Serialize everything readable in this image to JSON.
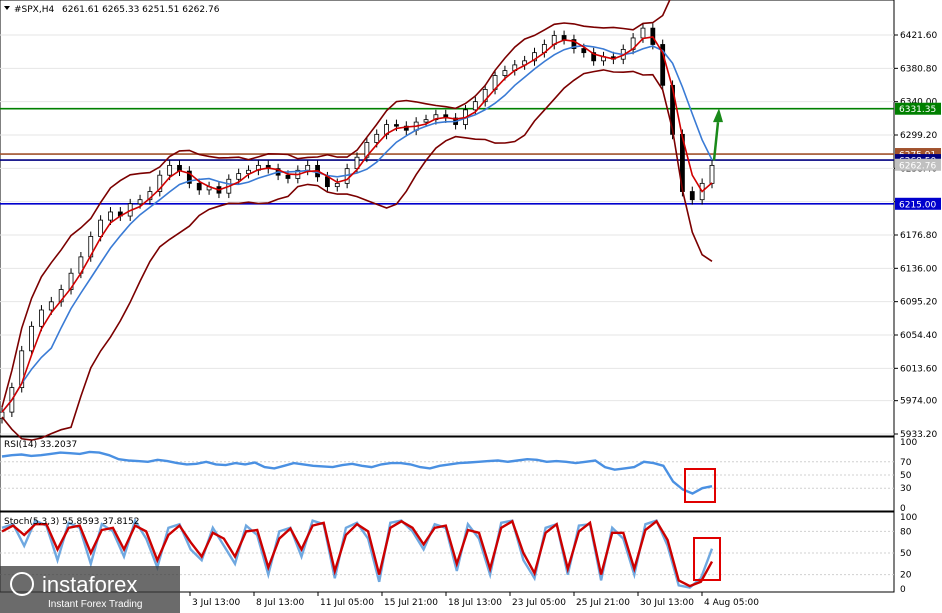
{
  "header": {
    "symbol": "#SPX,H4",
    "ohlc": "6261.61 6265.33 6251.51 6262.76"
  },
  "chart_data": [
    {
      "type": "candlestick",
      "panel": "price",
      "symbol": "#SPX",
      "timeframe": "H4",
      "ylim": [
        5933.2,
        6462
      ],
      "y_ticks": [
        "6421.60",
        "6380.80",
        "6340.00",
        "6299.20",
        "6258.40",
        "6217.60",
        "6176.80",
        "6136.00",
        "6095.20",
        "6054.40",
        "6013.60",
        "5974.00",
        "5933.20"
      ],
      "x_ticks": [
        "3 Jul 13:00",
        "8 Jul 13:00",
        "11 Jul 05:00",
        "15 Jul 21:00",
        "18 Jul 13:00",
        "23 Jul 05:00",
        "25 Jul 21:00",
        "30 Jul 13:00",
        "4 Aug 05:00"
      ],
      "price_levels": [
        {
          "value": 6331.35,
          "label": "6331.35",
          "color": "#008000"
        },
        {
          "value": 6275.91,
          "label": "6275.91",
          "color": "#a0522d"
        },
        {
          "value": 6268.5,
          "label": "6268.50",
          "color": "#000080"
        },
        {
          "value": 6262.76,
          "label": "6262.76",
          "color": "#c0c0c0"
        },
        {
          "value": 6215.0,
          "label": "6215.00",
          "color": "#0000cd"
        }
      ],
      "close_series": [
        5960,
        5990,
        6035,
        6065,
        6085,
        6095,
        6110,
        6130,
        6150,
        6175,
        6195,
        6205,
        6200,
        6215,
        6220,
        6230,
        6250,
        6262,
        6255,
        6240,
        6232,
        6236,
        6228,
        6245,
        6252,
        6256,
        6262,
        6258,
        6250,
        6246,
        6256,
        6262,
        6248,
        6236,
        6240,
        6258,
        6272,
        6290,
        6300,
        6312,
        6310,
        6305,
        6315,
        6318,
        6324,
        6320,
        6312,
        6330,
        6340,
        6355,
        6372,
        6378,
        6385,
        6390,
        6400,
        6410,
        6421,
        6416,
        6405,
        6400,
        6390,
        6395,
        6392,
        6404,
        6418,
        6430,
        6410,
        6360,
        6300,
        6230,
        6220,
        6240,
        6262
      ],
      "indicators": [
        "MA fast",
        "MA slow",
        "Bollinger Bands"
      ],
      "annotation": "up-arrow"
    },
    {
      "type": "line",
      "panel": "oscillator",
      "title": "RSI(14) 33.2037",
      "ylim": [
        0,
        100
      ],
      "y_ticks": [
        "100",
        "70",
        "50",
        "30",
        "0"
      ],
      "series": [
        {
          "name": "RSI(14)",
          "color": "#4a90e2",
          "values": [
            78,
            80,
            81,
            79,
            80,
            82,
            84,
            83,
            82,
            85,
            84,
            80,
            74,
            72,
            71,
            70,
            73,
            71,
            68,
            66,
            67,
            70,
            66,
            65,
            68,
            66,
            69,
            62,
            60,
            64,
            68,
            66,
            64,
            63,
            62,
            65,
            67,
            64,
            62,
            66,
            68,
            68,
            66,
            62,
            60,
            64,
            66,
            68,
            69,
            70,
            71,
            72,
            70,
            72,
            74,
            73,
            70,
            71,
            70,
            68,
            70,
            72,
            62,
            58,
            60,
            62,
            70,
            68,
            64,
            40,
            28,
            22,
            30,
            33
          ]
        }
      ],
      "annotation": "red-box"
    },
    {
      "type": "line",
      "panel": "oscillator",
      "title": "Stoch(5,3,3) 55.8593 37.8152",
      "ylim": [
        0,
        100
      ],
      "y_ticks": [
        "100",
        "80",
        "50",
        "20",
        "0"
      ],
      "series": [
        {
          "name": "%K",
          "color": "#6fa8e0",
          "values": [
            85,
            90,
            60,
            95,
            88,
            40,
            92,
            85,
            35,
            90,
            80,
            45,
            95,
            70,
            30,
            85,
            90,
            55,
            40,
            85,
            60,
            35,
            88,
            75,
            20,
            80,
            85,
            45,
            95,
            90,
            15,
            85,
            92,
            70,
            10,
            92,
            95,
            80,
            55,
            90,
            85,
            25,
            90,
            70,
            20,
            92,
            95,
            40,
            15,
            85,
            90,
            20,
            88,
            90,
            12,
            85,
            70,
            20,
            90,
            95,
            60,
            5,
            2,
            15,
            56
          ]
        },
        {
          "name": "%D",
          "color": "#cc0000",
          "values": [
            80,
            88,
            75,
            90,
            90,
            55,
            85,
            88,
            50,
            82,
            85,
            55,
            88,
            80,
            40,
            75,
            88,
            65,
            45,
            78,
            70,
            45,
            80,
            82,
            30,
            70,
            84,
            55,
            88,
            92,
            25,
            75,
            90,
            80,
            20,
            85,
            94,
            85,
            62,
            85,
            88,
            35,
            82,
            78,
            28,
            85,
            94,
            50,
            22,
            78,
            90,
            28,
            80,
            92,
            20,
            78,
            78,
            28,
            82,
            94,
            68,
            12,
            4,
            10,
            38
          ]
        }
      ],
      "annotation": "red-box"
    }
  ],
  "watermark": {
    "brand": "instaforex",
    "tagline": "Instant Forex Trading"
  }
}
